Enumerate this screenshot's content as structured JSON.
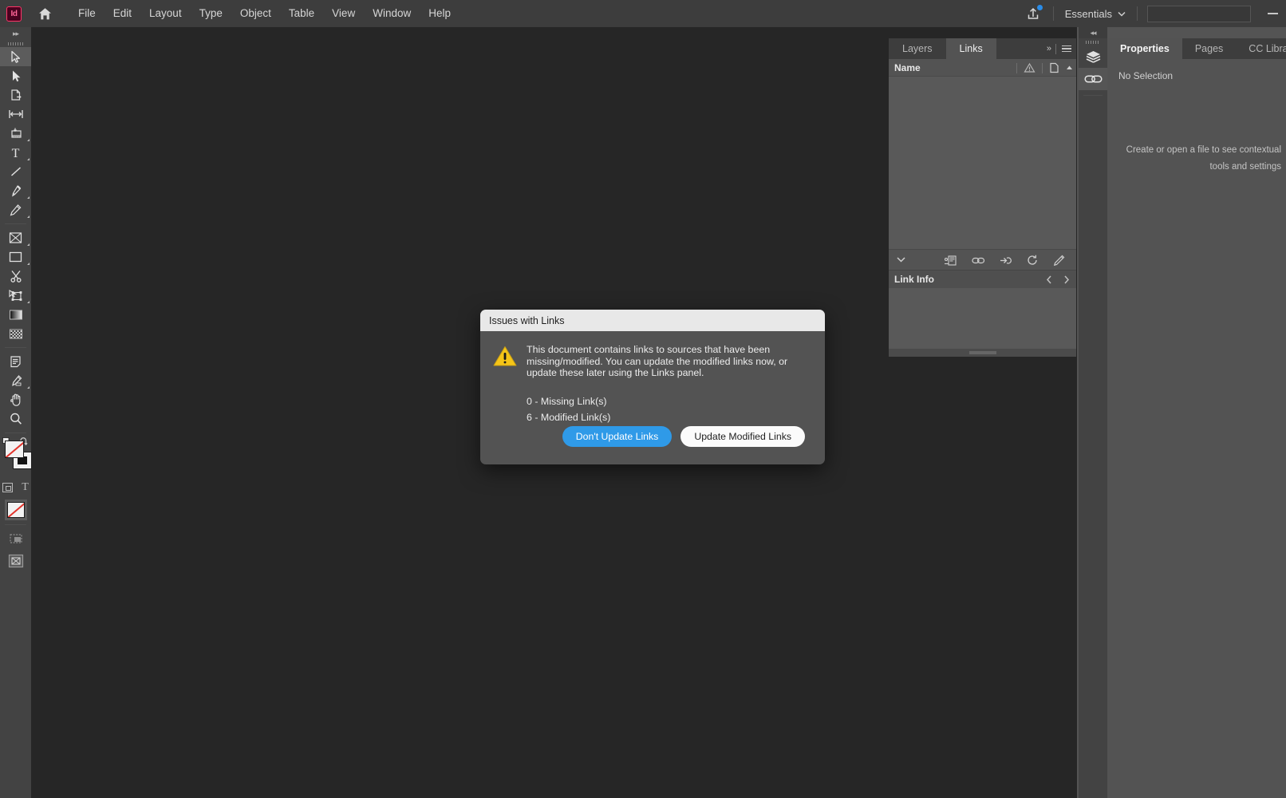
{
  "app": {
    "logo_text": "Id",
    "logo_icon": "indesign-logo-icon",
    "home_icon": "home-icon"
  },
  "menubar": {
    "items": [
      {
        "label": "File"
      },
      {
        "label": "Edit"
      },
      {
        "label": "Layout"
      },
      {
        "label": "Type"
      },
      {
        "label": "Object"
      },
      {
        "label": "Table"
      },
      {
        "label": "View"
      },
      {
        "label": "Window"
      },
      {
        "label": "Help"
      }
    ],
    "share_icon": "share-upload-icon",
    "workspace": "Essentials",
    "workspace_chevron": "chevron-down-icon",
    "search_placeholder": "",
    "search_value": "",
    "minimize_icon": "minimize-icon"
  },
  "toolbar": {
    "expand_icon": "double-chevron-right-icon",
    "grip_icon": "drag-grip-icon",
    "tools": [
      {
        "name": "selection-tool",
        "selected": true,
        "has_flyout": false
      },
      {
        "name": "direct-selection-tool",
        "selected": false,
        "has_flyout": false
      },
      {
        "name": "page-tool",
        "selected": false,
        "has_flyout": false
      },
      {
        "name": "gap-tool",
        "selected": false,
        "has_flyout": false
      },
      {
        "name": "content-collector-tool",
        "selected": false,
        "has_flyout": true
      },
      {
        "name": "type-tool",
        "selected": false,
        "has_flyout": true
      },
      {
        "name": "line-tool",
        "selected": false,
        "has_flyout": false
      },
      {
        "name": "pen-tool",
        "selected": false,
        "has_flyout": true
      },
      {
        "name": "pencil-tool",
        "selected": false,
        "has_flyout": true
      },
      {
        "name": "frame-tool",
        "selected": false,
        "has_flyout": true
      },
      {
        "name": "rectangle-tool",
        "selected": false,
        "has_flyout": true
      },
      {
        "name": "scissors-tool",
        "selected": false,
        "has_flyout": false
      },
      {
        "name": "free-transform-tool",
        "selected": false,
        "has_flyout": true
      },
      {
        "name": "gradient-swatch-tool",
        "selected": false,
        "has_flyout": false
      },
      {
        "name": "gradient-feather-tool",
        "selected": false,
        "has_flyout": false
      },
      {
        "name": "note-tool",
        "selected": false,
        "has_flyout": false
      },
      {
        "name": "eyedropper-tool",
        "selected": false,
        "has_flyout": true
      },
      {
        "name": "hand-tool",
        "selected": false,
        "has_flyout": false
      },
      {
        "name": "zoom-tool",
        "selected": false,
        "has_flyout": false
      }
    ],
    "fill_label": "Fill: None",
    "stroke_label": "Stroke: None",
    "swap_icon": "swap-fill-stroke-icon",
    "default_icon": "default-fill-stroke-icon",
    "container_icon": "formatting-affects-container-icon",
    "text_icon": "formatting-affects-text-icon",
    "apply_none_label": "Apply None",
    "screen_mode_icon": "screen-mode-icon",
    "preview_mode_icon": "preview-mode-icon"
  },
  "links_panel": {
    "tabs": [
      {
        "label": "Layers",
        "active": false
      },
      {
        "label": "Links",
        "active": true
      }
    ],
    "collapse_icon": "double-chevron-right-icon",
    "menu_icon": "panel-menu-icon",
    "column_name": "Name",
    "status_icon": "warning-triangle-icon",
    "page_icon": "page-sort-icon",
    "sort_icon": "sort-ascending-icon",
    "footer": {
      "expand_icon": "chevron-down-icon",
      "icons": [
        {
          "name": "relink-icon"
        },
        {
          "name": "go-to-link-icon"
        },
        {
          "name": "update-link-icon"
        },
        {
          "name": "refresh-link-icon"
        },
        {
          "name": "edit-original-icon"
        }
      ]
    },
    "link_info_title": "Link Info",
    "prev_icon": "chevron-left-icon",
    "next_icon": "chevron-right-icon",
    "resize_grip_icon": "resize-grip-icon"
  },
  "right_dock": {
    "collapse_icon": "double-chevron-left-icon",
    "rail_items": [
      {
        "name": "layers-rail-icon",
        "active": false
      },
      {
        "name": "links-rail-icon",
        "active": true
      }
    ],
    "tabs": [
      {
        "label": "Properties",
        "active": true
      },
      {
        "label": "Pages",
        "active": false
      },
      {
        "label": "CC Libraries",
        "active": false
      }
    ],
    "no_selection": "No Selection",
    "hint_line1": "Create or open a file to see contextual",
    "hint_line2": "tools and settings"
  },
  "dialog": {
    "title": "Issues with Links",
    "warning_icon": "warning-triangle-icon",
    "message": "This document contains links to sources that have been missing/modified. You can update the modified links now, or update these later using the Links panel.",
    "counts": [
      "0 - Missing Link(s)",
      "6 - Modified Link(s)"
    ],
    "primary_button": "Don't Update Links",
    "secondary_button": "Update Modified Links"
  },
  "colors": {
    "menubar_bg": "#3d3d3d",
    "toolbar_bg": "#434343",
    "canvas_bg": "#262626",
    "panel_bg": "#535353",
    "panel_body_bg": "#595959",
    "dialog_bg": "#535353",
    "dialog_title_bg": "#e8e8e8",
    "primary_button_bg": "#2f9ae8",
    "secondary_button_bg": "#fbfbfb",
    "warning_yellow": "#f5c518",
    "share_badge_blue": "#2a8ce8",
    "none_red": "#e2342c"
  }
}
